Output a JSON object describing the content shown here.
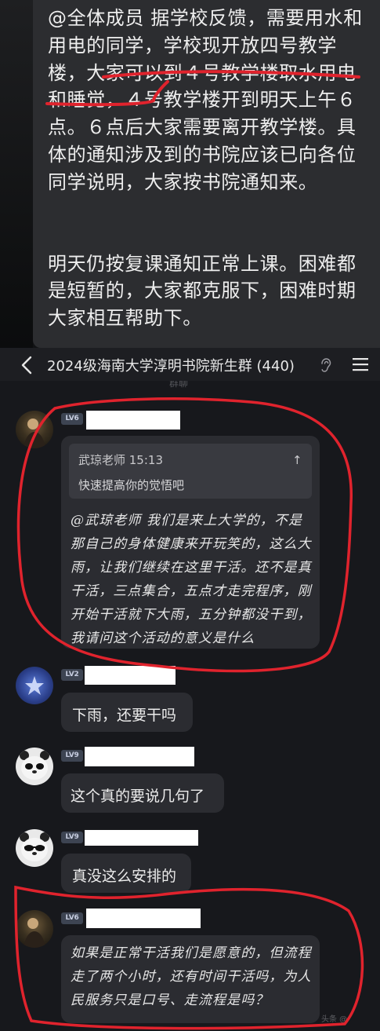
{
  "notice": {
    "paragraph1": "@全体成员 据学校反馈，需要用水和用电的同学，学校现开放四号教学楼，大家可以到４号教学楼取水用电和睡觉，４号教学楼开到明天上午６点。６点后大家需要离开教学楼。具体的通知涉及到的书院应该已向各位同学说明，大家按书院通知来。",
    "paragraph2": "明天仍按复课通知正常上课。困难都是短暂的，大家都克服下，困难时期大家相互帮助下。"
  },
  "header": {
    "title": "2024级海南大学淳明书院新生群 (440)",
    "hint": "群聊"
  },
  "messages": [
    {
      "level": "LV6",
      "quote_author": "武琼老师 15:13",
      "quote_text": "快速提高你的觉悟吧",
      "text": "@武琼老师 我们是来上大学的，不是那自己的身体健康来开玩笑的，这么大雨，让我们继续在这里干活。还不是真干活，三点集合，五点才走完程序，刚开始干活就下大雨，五分钟都没干到，我请问这个活动的意义是什么"
    },
    {
      "level": "LV2",
      "text": "下雨，还要干吗"
    },
    {
      "level": "LV9",
      "text": "这个真的要说几句了"
    },
    {
      "level": "LV9",
      "text": "真没这么安排的"
    },
    {
      "level": "LV6",
      "text": "如果是正常干活我们是愿意的，但流程走了两个小时，还有时间干活吗，为人民服务只是口号、走流程是吗？"
    }
  ],
  "watermark": "头条 @",
  "colors": {
    "annotation_red": "#e0232d",
    "bubble_bg": "#2b2c31",
    "chat_bg": "#17181c"
  },
  "icons": [
    "back-arrow-icon",
    "ear-icon",
    "menu-icon"
  ]
}
